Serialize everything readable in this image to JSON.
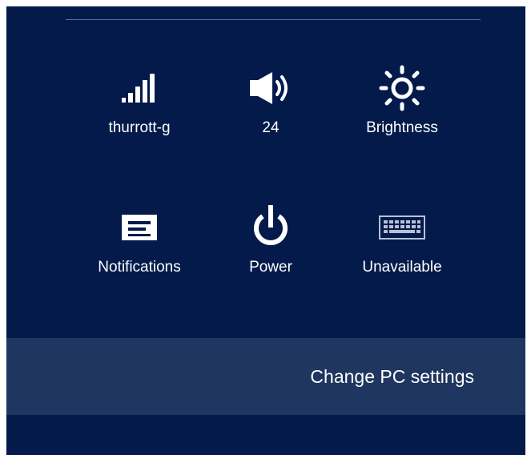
{
  "panel": {
    "background_color": "#031a4a",
    "bar_color": "#1e3660",
    "tiles": [
      {
        "label": "thurrott-g",
        "icon": "network-signal-icon"
      },
      {
        "label": "24",
        "icon": "volume-icon"
      },
      {
        "label": "Brightness",
        "icon": "brightness-icon"
      },
      {
        "label": "Notifications",
        "icon": "notifications-icon"
      },
      {
        "label": "Power",
        "icon": "power-icon"
      },
      {
        "label": "Unavailable",
        "icon": "keyboard-icon"
      }
    ],
    "change_pc_settings_label": "Change PC settings"
  }
}
